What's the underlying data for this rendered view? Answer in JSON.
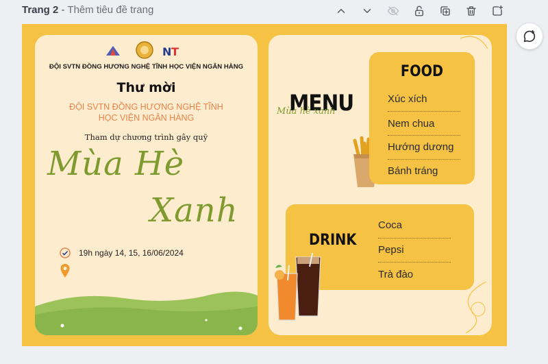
{
  "header": {
    "page_label": "Trang 2",
    "separator": " - ",
    "page_subtitle": "Thêm tiêu đề trang",
    "icons": [
      "chevron-up-icon",
      "chevron-down-icon",
      "eye-off-icon",
      "unlock-icon",
      "duplicate-icon",
      "trash-icon",
      "add-page-icon"
    ]
  },
  "invitation": {
    "org_name": "ĐỘI SVTN ĐỒNG HƯƠNG NGHỆ TĨNH HỌC VIỆN NGÂN HÀNG",
    "title": "Thư mời",
    "org_line1": "ĐỘI SVTN ĐỒNG HƯƠNG NGHỆ TĨNH",
    "org_line2": "HỌC VIỆN NGÂN HÀNG",
    "attend_text": "Tham dự chương trình gây quỹ",
    "event_line1": "Mùa Hè",
    "event_line2": "Xanh",
    "time_text": "19h ngày 14, 15, 16/06/2024"
  },
  "menu": {
    "heading": "MENU",
    "subheading": "Mùa hè xanh",
    "food_title": "FOOD",
    "food_items": [
      "Xúc xích",
      "Nem chua",
      "Hướng dương",
      "Bánh tráng"
    ],
    "drink_title": "DRINK",
    "drink_items": [
      "Coca",
      "Pepsi",
      "Trà đào"
    ]
  },
  "colors": {
    "canvas_bg": "#f5c243",
    "card_bg": "#fdeccd",
    "accent_orange": "#e9834c",
    "accent_green": "#7f9a2f"
  }
}
